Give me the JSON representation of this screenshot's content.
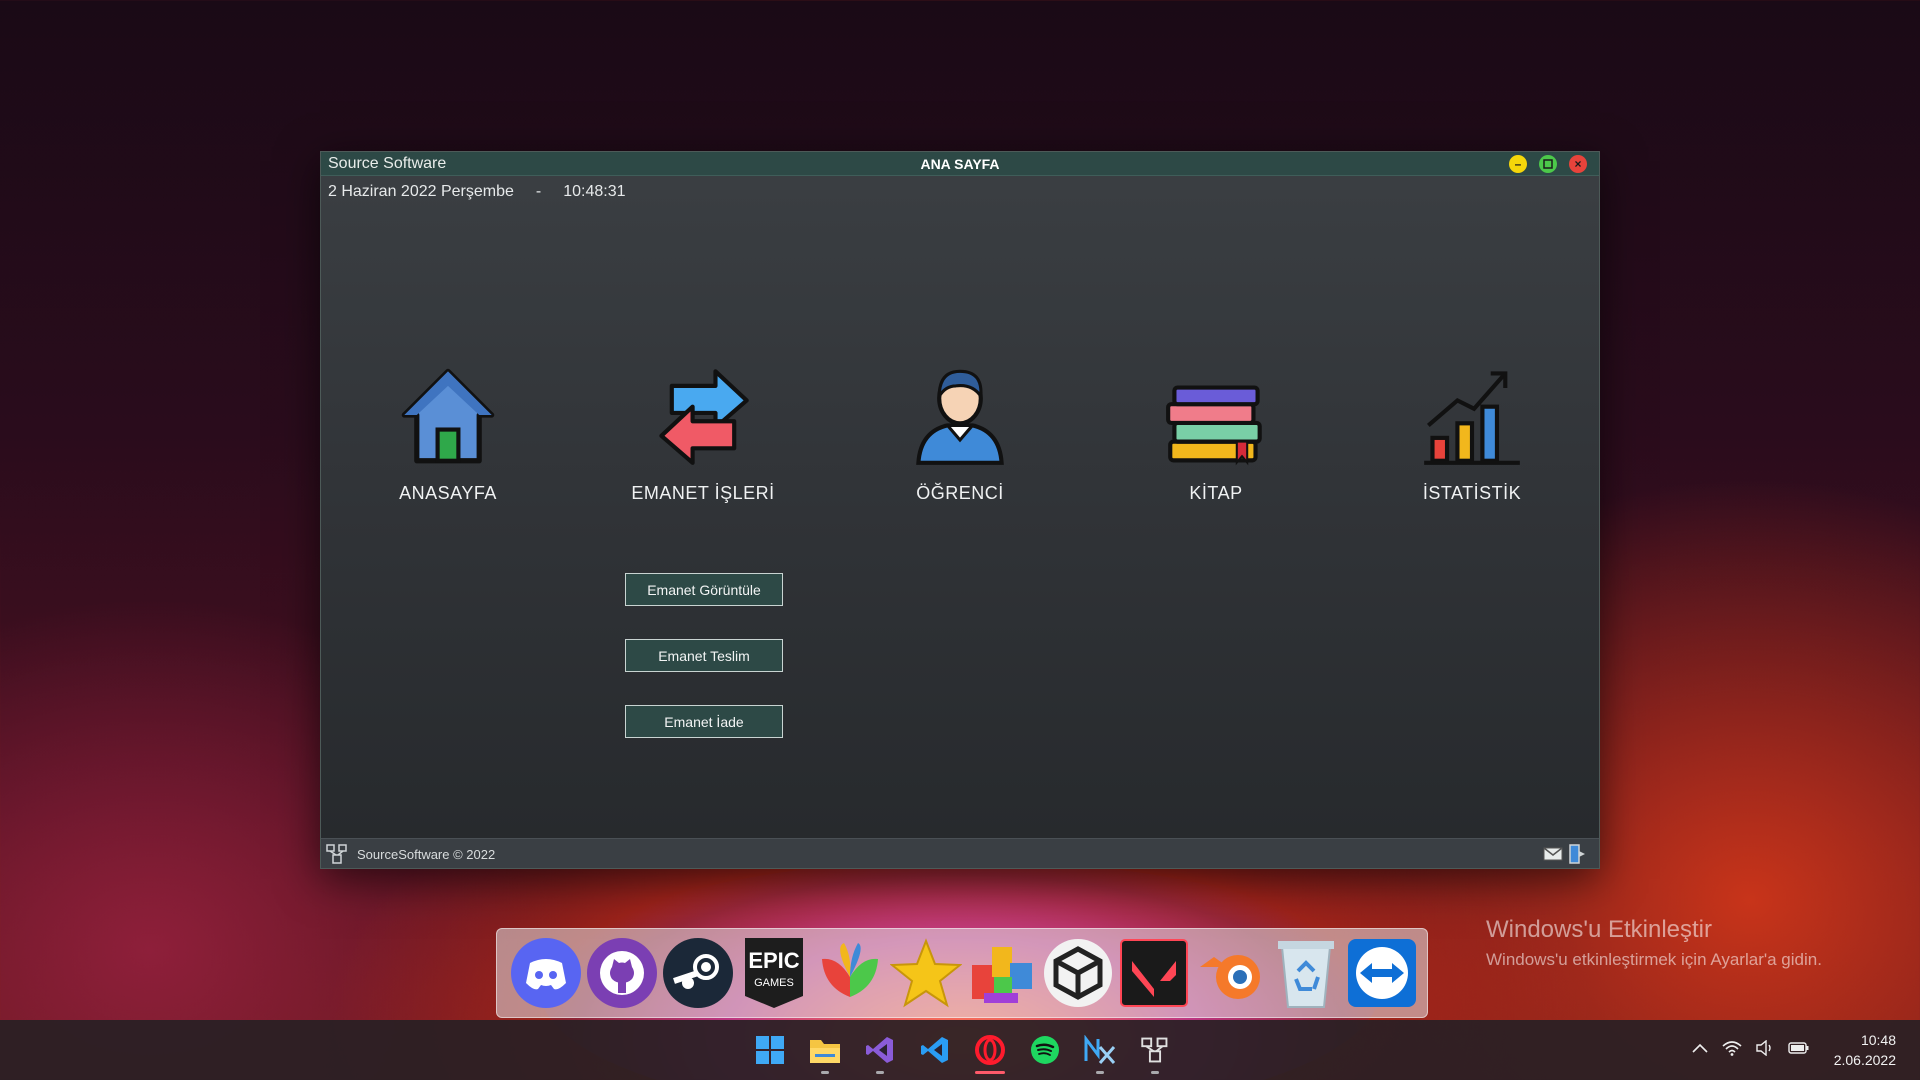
{
  "window": {
    "app_name": "Source Software",
    "page_title": "ANA SAYFA",
    "date": "2 Haziran 2022 Perşembe",
    "separator": "-",
    "time": "10:48:31"
  },
  "nav": [
    {
      "label": "ANASAYFA",
      "icon": "house-icon"
    },
    {
      "label": "EMANET İŞLERİ",
      "icon": "exchange-arrows-icon"
    },
    {
      "label": "ÖĞRENCİ",
      "icon": "student-icon"
    },
    {
      "label": "KİTAP",
      "icon": "books-icon"
    },
    {
      "label": "İSTATİSTİK",
      "icon": "statistics-chart-icon"
    }
  ],
  "actions": {
    "view": "Emanet Görüntüle",
    "deliver": "Emanet Teslim",
    "return": "Emanet İade"
  },
  "statusbar": {
    "copyright": "SourceSoftware © 2022"
  },
  "dock_apps": [
    "discord-icon",
    "github-icon",
    "steam-icon",
    "epic-games-icon",
    "msn-butterfly-icon",
    "star-icon",
    "blocks-app-icon",
    "unity-icon",
    "valorant-icon",
    "blender-icon",
    "recycle-bin-icon",
    "teamviewer-icon"
  ],
  "epic_label_1": "EPIC",
  "epic_label_2": "GAMES",
  "watermark": {
    "title": "Windows'u Etkinleştir",
    "subtitle": "Windows'u etkinleştirmek için Ayarlar'a gidin."
  },
  "taskbar": {
    "apps": [
      "windows-start-icon",
      "file-explorer-icon",
      "visual-studio-icon",
      "vscode-icon",
      "opera-icon",
      "spotify-icon",
      "nx-icon",
      "source-software-icon"
    ],
    "clock_time": "10:48",
    "clock_date": "2.06.2022"
  },
  "colors": {
    "titlebar": "#2d4946",
    "button_bg": "#2d4946",
    "minimize": "#f5d60a",
    "maximize": "#4cc84a",
    "close": "#e8433b"
  }
}
